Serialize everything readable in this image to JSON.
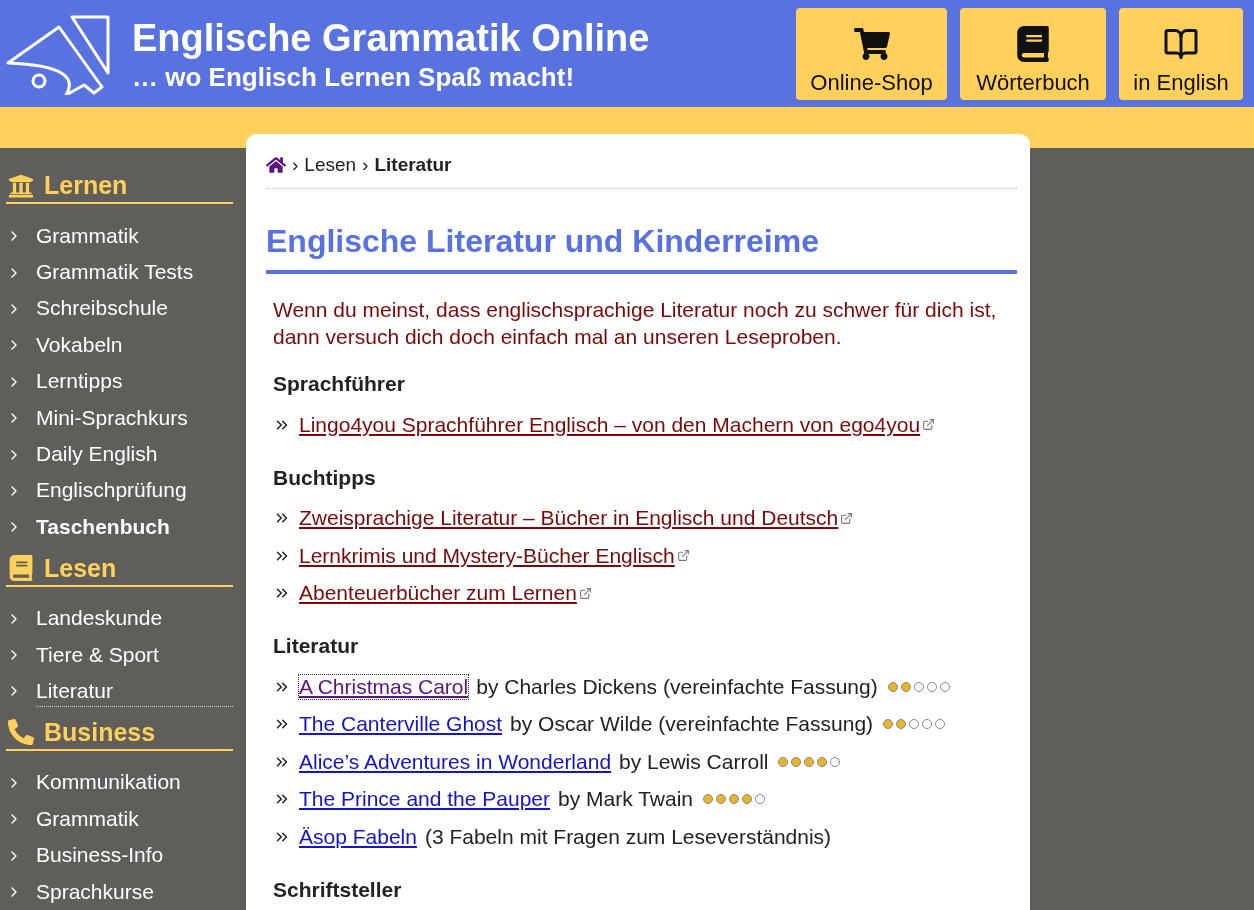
{
  "header": {
    "title": "Englische Grammatik Online",
    "tagline": "… wo Englisch Lernen Spaß macht!",
    "buttons": [
      {
        "kind": "cart",
        "label": "Online-Shop"
      },
      {
        "kind": "book",
        "label": "Wörterbuch"
      },
      {
        "kind": "language",
        "label": "in English"
      }
    ]
  },
  "sidebar": [
    {
      "kind": "building",
      "heading": "Lernen",
      "items": [
        {
          "label": "Grammatik",
          "selected": false,
          "bold": false
        },
        {
          "label": "Grammatik Tests",
          "selected": false,
          "bold": false
        },
        {
          "label": "Schreibschule",
          "selected": false,
          "bold": false
        },
        {
          "label": "Vokabeln",
          "selected": false,
          "bold": false
        },
        {
          "label": "Lerntipps",
          "selected": false,
          "bold": false
        },
        {
          "label": "Mini-Sprachkurs",
          "selected": false,
          "bold": false
        },
        {
          "label": "Daily English",
          "selected": false,
          "bold": false
        },
        {
          "label": "Englischprüfung",
          "selected": false,
          "bold": false
        },
        {
          "label": "Taschenbuch",
          "selected": false,
          "bold": true
        }
      ]
    },
    {
      "kind": "book",
      "heading": "Lesen",
      "items": [
        {
          "label": "Landeskunde",
          "selected": false,
          "bold": false
        },
        {
          "label": "Tiere & Sport",
          "selected": false,
          "bold": false
        },
        {
          "label": "Literatur",
          "selected": true,
          "bold": false
        }
      ]
    },
    {
      "kind": "phone",
      "heading": "Business",
      "items": [
        {
          "label": "Kommunikation",
          "selected": false,
          "bold": false
        },
        {
          "label": "Grammatik",
          "selected": false,
          "bold": false
        },
        {
          "label": "Business-Info",
          "selected": false,
          "bold": false
        },
        {
          "label": "Sprachkurse",
          "selected": false,
          "bold": false
        }
      ]
    }
  ],
  "breadcrumb": {
    "separator": "›",
    "items": [
      {
        "kind": "home"
      },
      {
        "kind": "link",
        "label": "Lesen"
      },
      {
        "kind": "current",
        "label": "Literatur"
      }
    ]
  },
  "page_title": "Englische Literatur und Kinderreime",
  "intro": "Wenn du meinst, dass englischsprachige Literatur noch zu schwer für dich ist, dann versuch dich doch einfach mal an unseren Leseproben.",
  "sections": [
    {
      "heading": "Sprachführer",
      "links": [
        {
          "kind": "external",
          "label": "Lingo4you Sprachführer Englisch – von den Machern von ego4you"
        }
      ]
    },
    {
      "heading": "Buchtipps",
      "links": [
        {
          "kind": "external",
          "label": "Zweisprachige Literatur – Bücher in Englisch und Deutsch"
        },
        {
          "kind": "external",
          "label": "Lernkrimis und Mystery-Bücher Englisch"
        },
        {
          "kind": "external",
          "label": "Abenteuerbücher zum Lernen"
        }
      ]
    },
    {
      "heading": "Literatur",
      "links": [
        {
          "kind": "internal",
          "label": "A Christmas Carol",
          "visited": true,
          "focused": true,
          "suffix": "by Charles Dickens (vereinfachte Fassung)",
          "stars": 2
        },
        {
          "kind": "internal",
          "label": "The Canterville Ghost",
          "visited": false,
          "focused": false,
          "suffix": "by Oscar Wilde (vereinfachte Fassung)",
          "stars": 2
        },
        {
          "kind": "internal",
          "label": "Alice’s Adventures in Wonderland",
          "visited": false,
          "focused": false,
          "suffix": "by Lewis Carroll",
          "stars": 4
        },
        {
          "kind": "internal",
          "label": "The Prince and the Pauper",
          "visited": false,
          "focused": false,
          "suffix": "by Mark Twain",
          "stars": 4
        },
        {
          "kind": "internal",
          "label": "Äsop Fabeln",
          "visited": false,
          "focused": false,
          "suffix": "(3 Fabeln mit Fragen zum Leseverständnis)"
        }
      ]
    },
    {
      "heading": "Schriftsteller"
    }
  ]
}
